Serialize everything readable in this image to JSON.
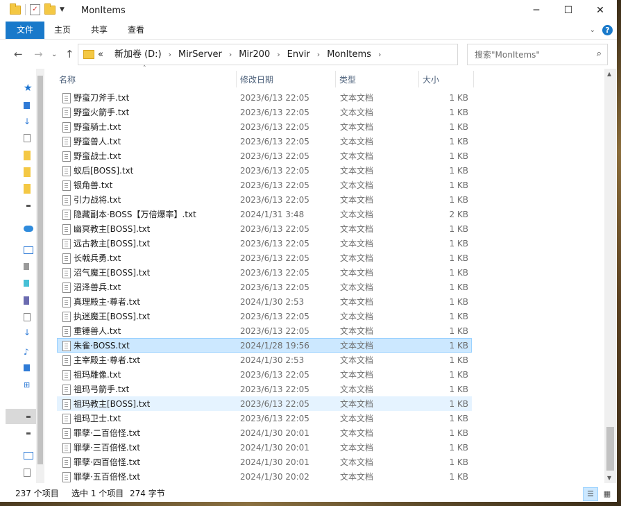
{
  "window": {
    "title": "MonItems",
    "controls": {
      "minimize": "─",
      "maximize": "☐",
      "close": "✕"
    }
  },
  "ribbon": {
    "tabs": [
      "文件",
      "主页",
      "共享",
      "查看"
    ]
  },
  "address": {
    "overflow": "«",
    "crumbs": [
      "新加卷 (D:)",
      "MirServer",
      "Mir200",
      "Envir",
      "MonItems"
    ]
  },
  "search": {
    "placeholder": "搜索\"MonItems\""
  },
  "columns": {
    "name": "名称",
    "date": "修改日期",
    "type": "类型",
    "size": "大小"
  },
  "files": [
    {
      "name": "野蛮刀斧手.txt",
      "date": "2023/6/13 22:05",
      "type": "文本文档",
      "size": "1 KB"
    },
    {
      "name": "野蛮火箭手.txt",
      "date": "2023/6/13 22:05",
      "type": "文本文档",
      "size": "1 KB"
    },
    {
      "name": "野蛮骑士.txt",
      "date": "2023/6/13 22:05",
      "type": "文本文档",
      "size": "1 KB"
    },
    {
      "name": "野蛮兽人.txt",
      "date": "2023/6/13 22:05",
      "type": "文本文档",
      "size": "1 KB"
    },
    {
      "name": "野蛮战士.txt",
      "date": "2023/6/13 22:05",
      "type": "文本文档",
      "size": "1 KB"
    },
    {
      "name": "蚁后[BOSS].txt",
      "date": "2023/6/13 22:05",
      "type": "文本文档",
      "size": "1 KB"
    },
    {
      "name": "银角兽.txt",
      "date": "2023/6/13 22:05",
      "type": "文本文档",
      "size": "1 KB"
    },
    {
      "name": "引力战将.txt",
      "date": "2023/6/13 22:05",
      "type": "文本文档",
      "size": "1 KB"
    },
    {
      "name": "隐藏副本·BOSS【万倍爆率】.txt",
      "date": "2024/1/31 3:48",
      "type": "文本文档",
      "size": "2 KB"
    },
    {
      "name": "幽冥教主[BOSS].txt",
      "date": "2023/6/13 22:05",
      "type": "文本文档",
      "size": "1 KB"
    },
    {
      "name": "远古教主[BOSS].txt",
      "date": "2023/6/13 22:05",
      "type": "文本文档",
      "size": "1 KB"
    },
    {
      "name": "长戟兵勇.txt",
      "date": "2023/6/13 22:05",
      "type": "文本文档",
      "size": "1 KB"
    },
    {
      "name": "沼气魔王[BOSS].txt",
      "date": "2023/6/13 22:05",
      "type": "文本文档",
      "size": "1 KB"
    },
    {
      "name": "沼泽兽兵.txt",
      "date": "2023/6/13 22:05",
      "type": "文本文档",
      "size": "1 KB"
    },
    {
      "name": "真理殿主·尊者.txt",
      "date": "2024/1/30 2:53",
      "type": "文本文档",
      "size": "1 KB"
    },
    {
      "name": "执迷魔王[BOSS].txt",
      "date": "2023/6/13 22:05",
      "type": "文本文档",
      "size": "1 KB"
    },
    {
      "name": "重锤兽人.txt",
      "date": "2023/6/13 22:05",
      "type": "文本文档",
      "size": "1 KB"
    },
    {
      "name": "朱雀·BOSS.txt",
      "date": "2024/1/28 19:56",
      "type": "文本文档",
      "size": "1 KB",
      "state": "sel"
    },
    {
      "name": "主宰殿主·尊者.txt",
      "date": "2024/1/30 2:53",
      "type": "文本文档",
      "size": "1 KB"
    },
    {
      "name": "祖玛雕像.txt",
      "date": "2023/6/13 22:05",
      "type": "文本文档",
      "size": "1 KB"
    },
    {
      "name": "祖玛弓箭手.txt",
      "date": "2023/6/13 22:05",
      "type": "文本文档",
      "size": "1 KB"
    },
    {
      "name": "祖玛教主[BOSS].txt",
      "date": "2023/6/13 22:05",
      "type": "文本文档",
      "size": "1 KB",
      "state": "hov"
    },
    {
      "name": "祖玛卫士.txt",
      "date": "2023/6/13 22:05",
      "type": "文本文档",
      "size": "1 KB"
    },
    {
      "name": "罪孽·二百倍怪.txt",
      "date": "2024/1/30 20:01",
      "type": "文本文档",
      "size": "1 KB"
    },
    {
      "name": "罪孽·三百倍怪.txt",
      "date": "2024/1/30 20:01",
      "type": "文本文档",
      "size": "1 KB"
    },
    {
      "name": "罪孽·四百倍怪.txt",
      "date": "2024/1/30 20:01",
      "type": "文本文档",
      "size": "1 KB"
    },
    {
      "name": "罪孽·五百倍怪.txt",
      "date": "2024/1/30 20:02",
      "type": "文本文档",
      "size": "1 KB"
    }
  ],
  "status": {
    "count": "237 个项目",
    "selected": "选中 1 个项目",
    "size": "274 字节"
  },
  "colors": {
    "accent": "#1979ca",
    "selection": "#cce8ff",
    "hover": "#e5f3ff"
  },
  "icons": [
    "folder-icon",
    "properties-icon",
    "back-arrow-icon",
    "forward-arrow-icon",
    "up-arrow-icon",
    "refresh-icon",
    "search-icon",
    "text-file-icon",
    "help-icon"
  ]
}
